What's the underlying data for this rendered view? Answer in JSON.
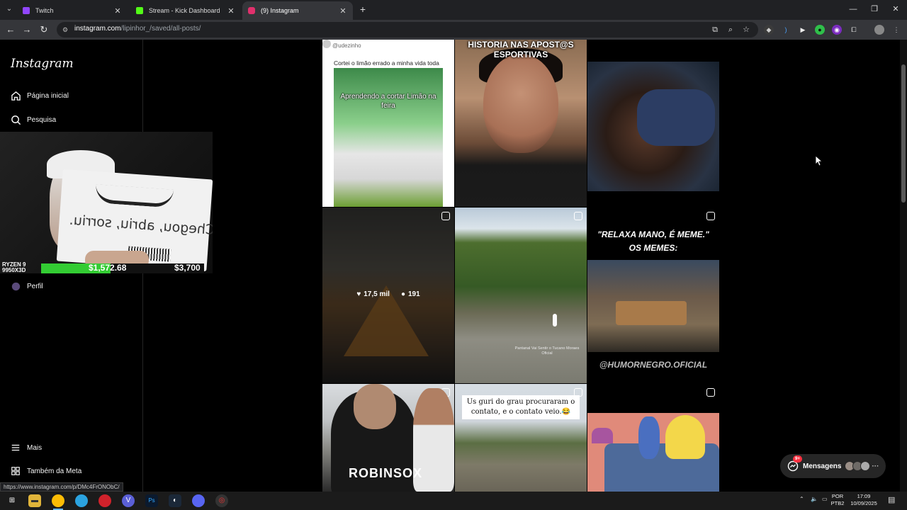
{
  "browser": {
    "tabs": [
      {
        "title": "Twitch",
        "color": "#9146ff",
        "active": false
      },
      {
        "title": "Stream - Kick Dashboard",
        "color": "#53fc18",
        "active": false
      },
      {
        "title": "(9) Instagram",
        "color": "#e1306c",
        "active": true
      }
    ],
    "url_domain": "instagram.com",
    "url_path": "/lipinhor_/saved/all-posts/",
    "status_url": "https://www.instagram.com/p/DMc4FrONObC/"
  },
  "sidebar": {
    "logo": "Instagram",
    "items": [
      {
        "label": "Página inicial",
        "icon": "home-icon"
      },
      {
        "label": "Pesquisa",
        "icon": "search-icon"
      },
      {
        "label": "Perfil",
        "icon": "profile-avatar"
      },
      {
        "label": "Mais",
        "icon": "menu-icon"
      },
      {
        "label": "Também da Meta",
        "icon": "meta-icon"
      }
    ]
  },
  "overlay": {
    "paper_text": "Chegou, abriu, sorriu.",
    "cpu_label": "RYZEN 9 9950X3D",
    "goal_current": "$1,572.68",
    "goal_target": "$3,700",
    "goal_fraction": 0.425,
    "goal_color": "#33cc33"
  },
  "posts": [
    {
      "handle": "@udezinho",
      "caption": "Cortei o limão errado a minha vida toda",
      "overlay": "Aprendendo a cortar Limão na feira"
    },
    {
      "headline": "HISTORIA NAS APOST@S ESPORTIVAS"
    },
    {},
    {
      "likes": "17,5 mil",
      "comments": "191"
    },
    {
      "watermark": "Pantanal Vai Sentir o Tucano Moraes Oficial"
    },
    {
      "quote_line1": "\"RELAXA MANO, É MEME.\"",
      "quote_line2": "OS MEMES:",
      "tag": "@HUMORNEGRO.OFICIAL"
    },
    {
      "jersey": "ROBINSOX"
    },
    {
      "caption": "Us guri do grau procuraram o contato, e o contato veio.😂"
    },
    {}
  ],
  "messages": {
    "label": "Mensagens",
    "badge": "9+"
  },
  "taskbar": {
    "lang_line1": "POR",
    "lang_line2": "PTB2",
    "time": "17:09",
    "date": "10/09/2025"
  }
}
